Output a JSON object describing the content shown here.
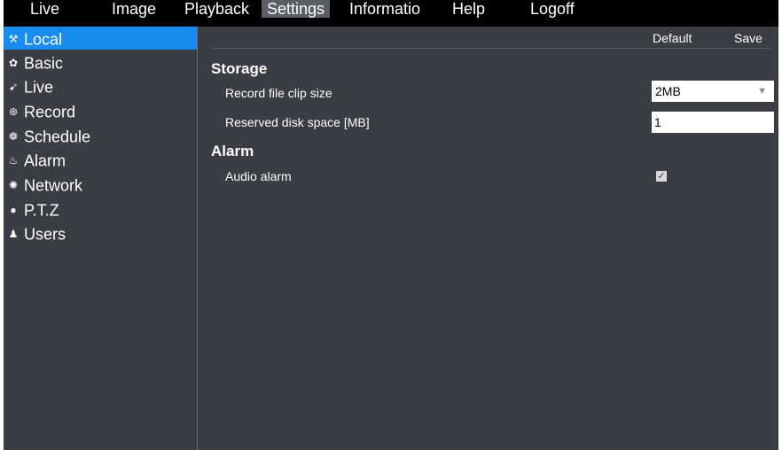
{
  "menu": {
    "tabs": [
      {
        "label": "Live"
      },
      {
        "label": "Image"
      },
      {
        "label": "Playback"
      },
      {
        "label": "Settings"
      },
      {
        "label": "Informatio"
      },
      {
        "label": "Help"
      },
      {
        "label": "Logoff"
      }
    ],
    "active": "Settings"
  },
  "sidebar": {
    "items": [
      {
        "icon": "tools-icon",
        "glyph": "⚒",
        "label": "Local"
      },
      {
        "icon": "gear-icon",
        "glyph": "✿",
        "label": "Basic"
      },
      {
        "icon": "eye-icon",
        "glyph": "➹",
        "label": "Live"
      },
      {
        "icon": "record-icon",
        "glyph": "⊛",
        "label": "Record"
      },
      {
        "icon": "schedule-icon",
        "glyph": "❁",
        "label": "Schedule"
      },
      {
        "icon": "alarm-icon",
        "glyph": "♨",
        "label": "Alarm"
      },
      {
        "icon": "network-icon",
        "glyph": "✺",
        "label": "Network"
      },
      {
        "icon": "ptz-icon",
        "glyph": "●",
        "label": "P.T.Z"
      },
      {
        "icon": "users-icon",
        "glyph": "♟",
        "label": "Users"
      }
    ],
    "active": "Local"
  },
  "toolbar": {
    "default_label": "Default",
    "save_label": "Save"
  },
  "storage": {
    "title": "Storage",
    "clip_size_label": "Record file clip size",
    "clip_size_value": "2MB",
    "reserved_label": "Reserved disk space [MB]",
    "reserved_value": "1"
  },
  "alarm": {
    "title": "Alarm",
    "audio_label": "Audio alarm",
    "audio_checked": true
  },
  "colors": {
    "accent": "#1a8cf0",
    "background": "#3a3d44",
    "topbar": "#000000"
  }
}
